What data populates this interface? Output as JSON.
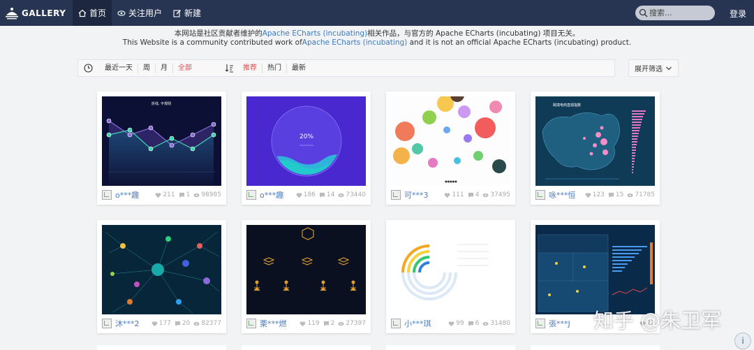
{
  "nav": {
    "logo_text": "GALLERY",
    "items": [
      {
        "label": "首页",
        "icon": "home-icon",
        "active": true
      },
      {
        "label": "关注用户",
        "icon": "eye-icon",
        "active": false
      },
      {
        "label": "新建",
        "icon": "edit-icon",
        "active": false
      }
    ],
    "search_placeholder": "搜索...",
    "login_label": "登录"
  },
  "notice": {
    "line1_pre": "本网站是社区贡献者维护的",
    "line1_link": "Apache ECharts (incubating)",
    "line1_post": "相关作品，与官方的 Apache ECharts (incubating) 项目无关。",
    "line2_pre": "This Website is a community contributed work of",
    "line2_link": "Apache ECharts (incubating)",
    "line2_post": " and it is not an official Apache ECharts (incubating) product."
  },
  "filter": {
    "time_items": [
      "最近一天",
      "周",
      "月",
      "全部"
    ],
    "active_time": "全部",
    "sort_items": [
      "推荐",
      "热门",
      "最新"
    ],
    "active_sort": "推荐",
    "expand_label": "展开筛选"
  },
  "cards": [
    {
      "author": "o***趣",
      "likes": "211",
      "comments": "1",
      "views": "98985",
      "thumb_title": "折线, 不规则"
    },
    {
      "author": "o***趣",
      "likes": "186",
      "comments": "14",
      "views": "73440",
      "thumb_label": "20%"
    },
    {
      "author": "可***3",
      "likes": "111",
      "comments": "4",
      "views": "37495"
    },
    {
      "author": "咏***恒",
      "likes": "123",
      "comments": "15",
      "views": "71785",
      "thumb_title": "跨境电商直观指数"
    },
    {
      "author": "沐***2",
      "likes": "177",
      "comments": "20",
      "views": "82377"
    },
    {
      "author": "栗***燃",
      "likes": "119",
      "comments": "2",
      "views": "27397"
    },
    {
      "author": "小***琪",
      "likes": "99",
      "comments": "6",
      "views": "31480"
    },
    {
      "author": "張***J",
      "likes": "22",
      "comments": "",
      "views": ""
    }
  ],
  "watermark": "知乎 @朱卫军",
  "info_label": "i"
}
